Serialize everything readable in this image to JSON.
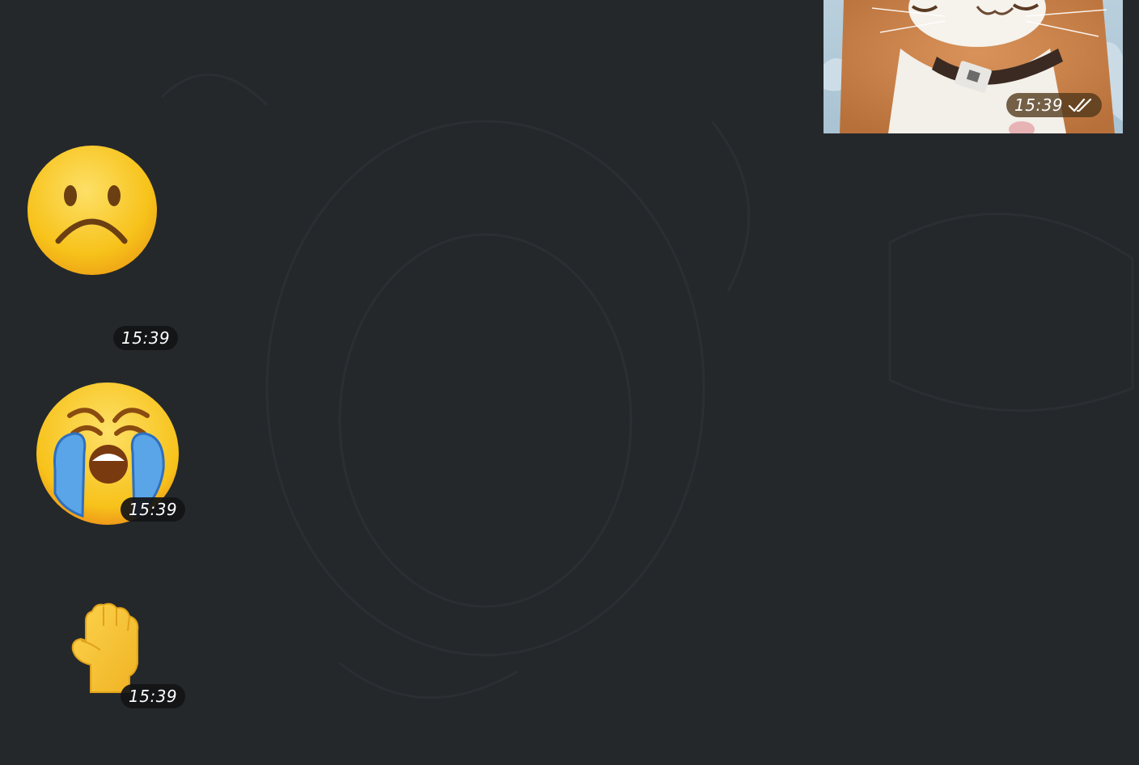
{
  "conversation": {
    "background_color": "#25282b",
    "messages": [
      {
        "kind": "photo",
        "direction": "outgoing",
        "description_icon": "cat-photo",
        "time": "15:39",
        "status_icon": "double-check-icon"
      },
      {
        "kind": "sticker",
        "direction": "incoming",
        "emoji_icon": "frowning-face-icon",
        "time": "15:39"
      },
      {
        "kind": "sticker",
        "direction": "incoming",
        "emoji_icon": "loudly-crying-face-icon",
        "time": "15:39"
      },
      {
        "kind": "sticker",
        "direction": "incoming",
        "emoji_icon": "raised-fist-icon",
        "time": "15:39"
      }
    ]
  },
  "colors": {
    "bubble_time_dark": "#121416",
    "bubble_time_photo": "#503719",
    "emoji_yellow": "#f7c21a",
    "tear_blue": "#5aa4e8"
  }
}
